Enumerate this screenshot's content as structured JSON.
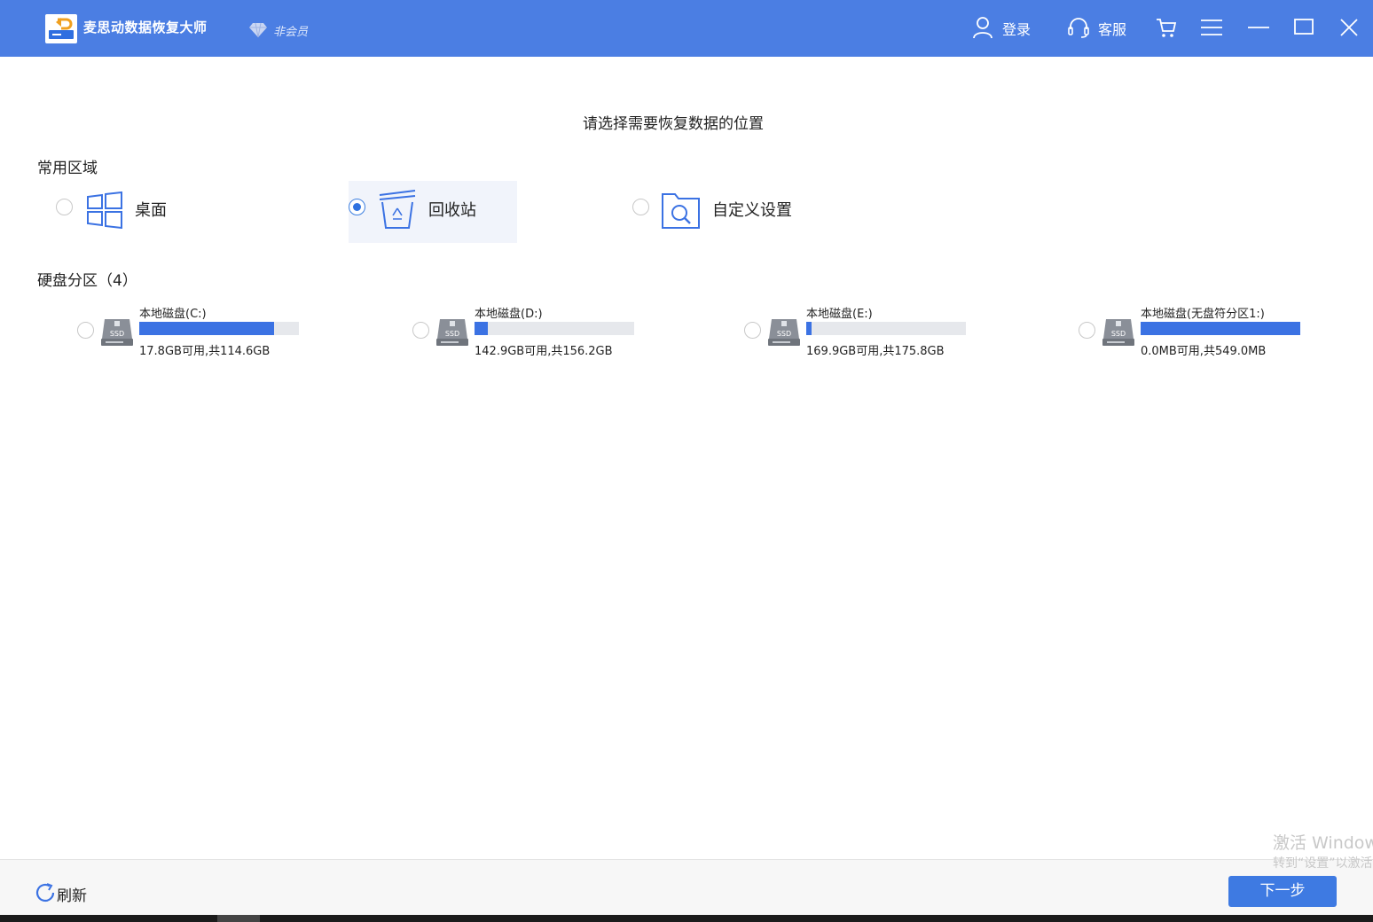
{
  "app": {
    "title": "麦思动数据恢复大师",
    "membership": "非会员"
  },
  "header": {
    "login_label": "登录",
    "service_label": "客服"
  },
  "main": {
    "title": "请选择需要恢复数据的位置"
  },
  "common": {
    "section_label": "常用区域",
    "items": [
      {
        "label": "桌面",
        "icon": "windows-icon",
        "checked": false
      },
      {
        "label": "回收站",
        "icon": "recycle-bin-icon",
        "checked": true
      },
      {
        "label": "自定义设置",
        "icon": "folder-search-icon",
        "checked": false
      }
    ]
  },
  "disks": {
    "section_label": "硬盘分区（4）",
    "items": [
      {
        "name": "本地磁盘(C:)",
        "size_text": "17.8GB可用,共114.6GB",
        "used_fraction": 0.845,
        "icon": "ssd-icon"
      },
      {
        "name": "本地磁盘(D:)",
        "size_text": "142.9GB可用,共156.2GB",
        "used_fraction": 0.085,
        "icon": "ssd-icon"
      },
      {
        "name": "本地磁盘(E:)",
        "size_text": "169.9GB可用,共175.8GB",
        "used_fraction": 0.034,
        "icon": "ssd-icon"
      },
      {
        "name": "本地磁盘(无盘符分区1:)",
        "size_text": "0.0MB可用,共549.0MB",
        "used_fraction": 1.0,
        "icon": "ssd-icon"
      }
    ]
  },
  "footer": {
    "refresh_label": "刷新",
    "next_label": "下一步"
  },
  "watermark": {
    "line1": "激活 Windows",
    "line2": "转到“设置”以激活"
  },
  "colors": {
    "brand": "#4b7ee3",
    "accent": "#3b72e3"
  }
}
